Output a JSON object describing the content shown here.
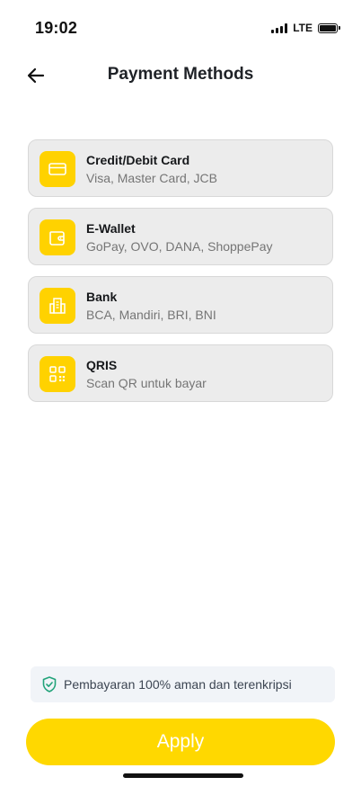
{
  "status_bar": {
    "time": "19:02",
    "network": "LTE"
  },
  "header": {
    "title": "Payment Methods",
    "back_icon": "arrow-left-icon"
  },
  "methods": [
    {
      "title": "Credit/Debit Card",
      "subtitle": "Visa, Master Card, JCB",
      "icon": "credit-card-icon"
    },
    {
      "title": "E-Wallet",
      "subtitle": "GoPay, OVO, DANA, ShoppePay",
      "icon": "wallet-icon"
    },
    {
      "title": "Bank",
      "subtitle": "BCA, Mandiri, BRI, BNI",
      "icon": "bank-building-icon"
    },
    {
      "title": "QRIS",
      "subtitle": "Scan QR untuk bayar",
      "icon": "qr-code-icon"
    }
  ],
  "secure_note": {
    "text": "Pembayaran 100% aman dan terenkripsi",
    "icon": "shield-check-icon"
  },
  "apply_label": "Apply",
  "colors": {
    "accent": "#FFD200",
    "card_bg": "#ECECEC",
    "secure_icon": "#22A37A"
  }
}
